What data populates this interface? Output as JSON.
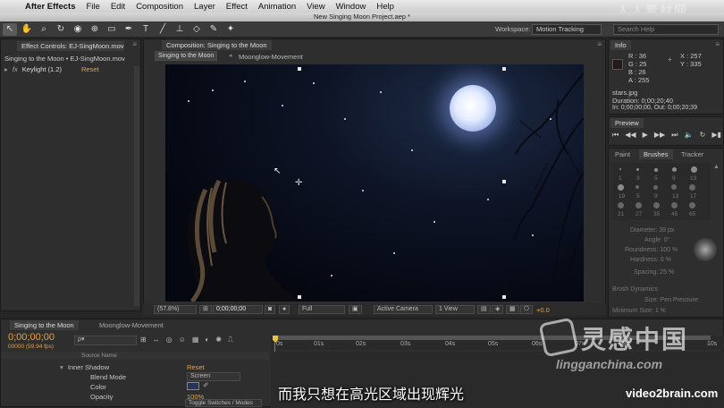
{
  "menubar": {
    "app_name": "After Effects",
    "items": [
      "File",
      "Edit",
      "Composition",
      "Layer",
      "Effect",
      "Animation",
      "View",
      "Window",
      "Help"
    ]
  },
  "window_title": "New Singing Moon Project.aep *",
  "toolbar": {
    "workspace_label": "Workspace:",
    "workspace_value": "Motion Tracking",
    "search_placeholder": "Search Help"
  },
  "effect_controls": {
    "tab": "Effect Controls: EJ-SingMoon.mov",
    "header": "Singing to the Moon • EJ-SingMoon.mov",
    "effect_name": "Keylight (1.2)",
    "reset_label": "Reset"
  },
  "composition": {
    "tab": "Composition: Singing to the Moon",
    "breadcrumbs": [
      "Singing to the Moon",
      "Moonglow-Movement"
    ],
    "zoom": "(57.8%)",
    "timecode": "0;00;00;00",
    "resolution": "Full",
    "camera": "Active Camera",
    "views": "1 View",
    "exposure": "+0.0"
  },
  "info": {
    "tab": "Info",
    "r_label": "R :",
    "r": "36",
    "g_label": "G :",
    "g": "25",
    "b_label": "B :",
    "b": "26",
    "a_label": "A :",
    "a": "255",
    "x": "X : 257",
    "y": "Y : 335",
    "file_name": "stars.jpg",
    "duration": "Duration: 0;00;20;40",
    "in_out": "In: 0;00;00;00, Out: 0;00;20;39"
  },
  "preview": {
    "tab": "Preview"
  },
  "brushes": {
    "tabs": [
      "Paint",
      "Brushes",
      "Tracker"
    ],
    "numbers": [
      "1",
      "3",
      "5",
      "9",
      "13",
      "19",
      "5",
      "9",
      "13",
      "17",
      "21",
      "27",
      "35",
      "45",
      "65"
    ],
    "diameter": "Diameter: 39 px",
    "angle": "Angle: 0°",
    "roundness": "Roundness: 100 %",
    "hardness": "Hardness: 0 %",
    "spacing": "Spacing: 25 %",
    "dynamics": "Brush Dynamics",
    "size": "Size: Pen Pressure",
    "min_size": "Minimum Size: 1 %"
  },
  "timeline": {
    "tabs": [
      "Singing to the Moon",
      "Moonglow-Movement"
    ],
    "timecode": "0;00;00;00",
    "fps": "00000 (59.94 fps)",
    "search_placeholder": "ρ▾",
    "column_source": "Source Name",
    "ruler": [
      "0s",
      "01s",
      "02s",
      "03s",
      "04s",
      "05s",
      "06s",
      "07s",
      "08s",
      "10s"
    ],
    "properties": [
      {
        "name": "Inner Shadow",
        "value": "Reset"
      },
      {
        "name": "Blend Mode",
        "value": "Screen"
      },
      {
        "name": "Color",
        "value": ""
      },
      {
        "name": "Opacity",
        "value": "100%"
      }
    ],
    "footer": "Toggle Switches / Modes"
  },
  "subtitle": "而我只想在高光区域出现辉光",
  "watermarks": {
    "top": "人人素材网",
    "brand": "灵感中国",
    "url": "lingganchina.com",
    "corner": "video2brain.com"
  }
}
